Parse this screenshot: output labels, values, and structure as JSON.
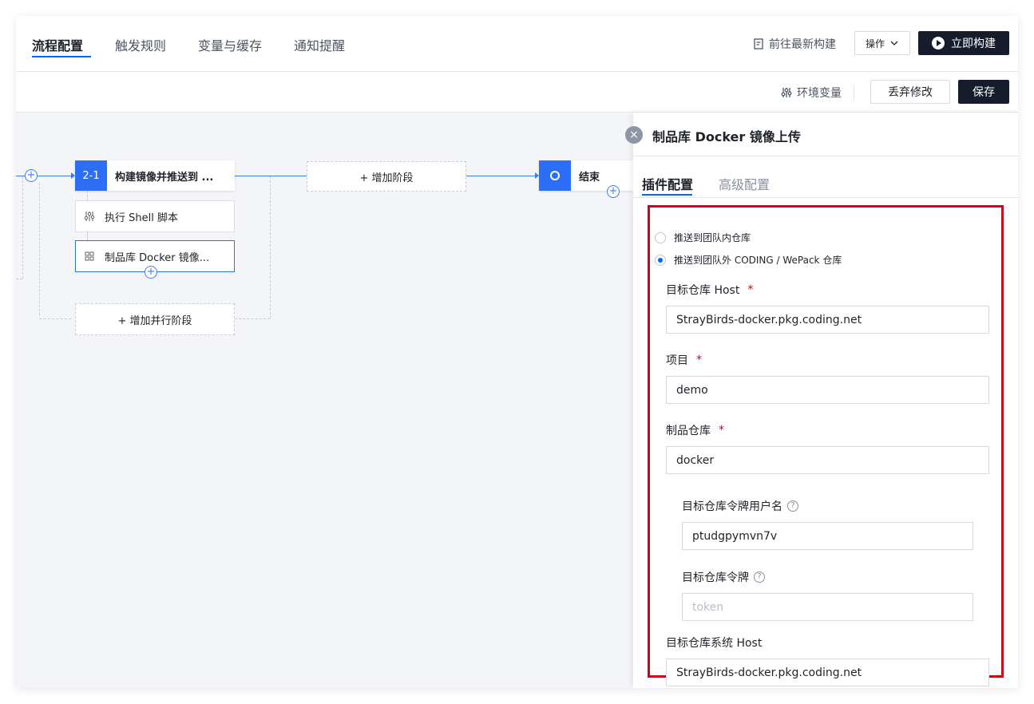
{
  "header": {
    "tabs": [
      {
        "label": "流程配置",
        "active": true
      },
      {
        "label": "触发规则",
        "active": false
      },
      {
        "label": "变量与缓存",
        "active": false
      },
      {
        "label": "通知提醒",
        "active": false
      }
    ],
    "latest_build_link": "前往最新构建",
    "ops_label": "操作",
    "build_now_label": "立即构建"
  },
  "toolbar": {
    "env_var_label": "环境变量",
    "discard_label": "丢弃修改",
    "save_label": "保存"
  },
  "pipeline": {
    "stage": {
      "badge": "2-1",
      "title": "构建镜像并推送到 ..."
    },
    "steps": [
      {
        "label": "执行 Shell 脚本",
        "icon": "sliders-icon"
      },
      {
        "label": "制品库 Docker 镜像...",
        "icon": "grid-icon",
        "selected": true
      }
    ],
    "add_stage_label": "+ 增加阶段",
    "add_parallel_label": "+ 增加并行阶段",
    "end_label": "结束",
    "plus_symbol": "+"
  },
  "panel": {
    "close_symbol": "×",
    "title": "制品库 Docker 镜像上传",
    "tabs": [
      {
        "label": "插件配置",
        "active": true
      },
      {
        "label": "高级配置",
        "active": false
      }
    ],
    "radios": [
      {
        "label": "推送到团队内仓库",
        "checked": false
      },
      {
        "label": "推送到团队外 CODING / WePack 仓库",
        "checked": true
      }
    ],
    "fields": {
      "target_host": {
        "label": "目标仓库 Host",
        "required_mark": "*",
        "value": "StrayBirds-docker.pkg.coding.net"
      },
      "project": {
        "label": "项目",
        "required_mark": "*",
        "value": "demo"
      },
      "repo": {
        "label": "制品仓库",
        "required_mark": "*",
        "value": "docker"
      },
      "token_user": {
        "label": "目标仓库令牌用户名",
        "help": "?",
        "value": "ptudgpymvn7v"
      },
      "token": {
        "label": "目标仓库令牌",
        "help": "?",
        "value": "",
        "placeholder": "token"
      },
      "system_host": {
        "label": "目标仓库系统 Host",
        "value": "StrayBirds-docker.pkg.coding.net"
      }
    }
  },
  "colors": {
    "accent": "#0066ff",
    "dark_button": "#161c2b",
    "highlight_border": "#d0021b",
    "node_blue": "#2d6ef7"
  }
}
